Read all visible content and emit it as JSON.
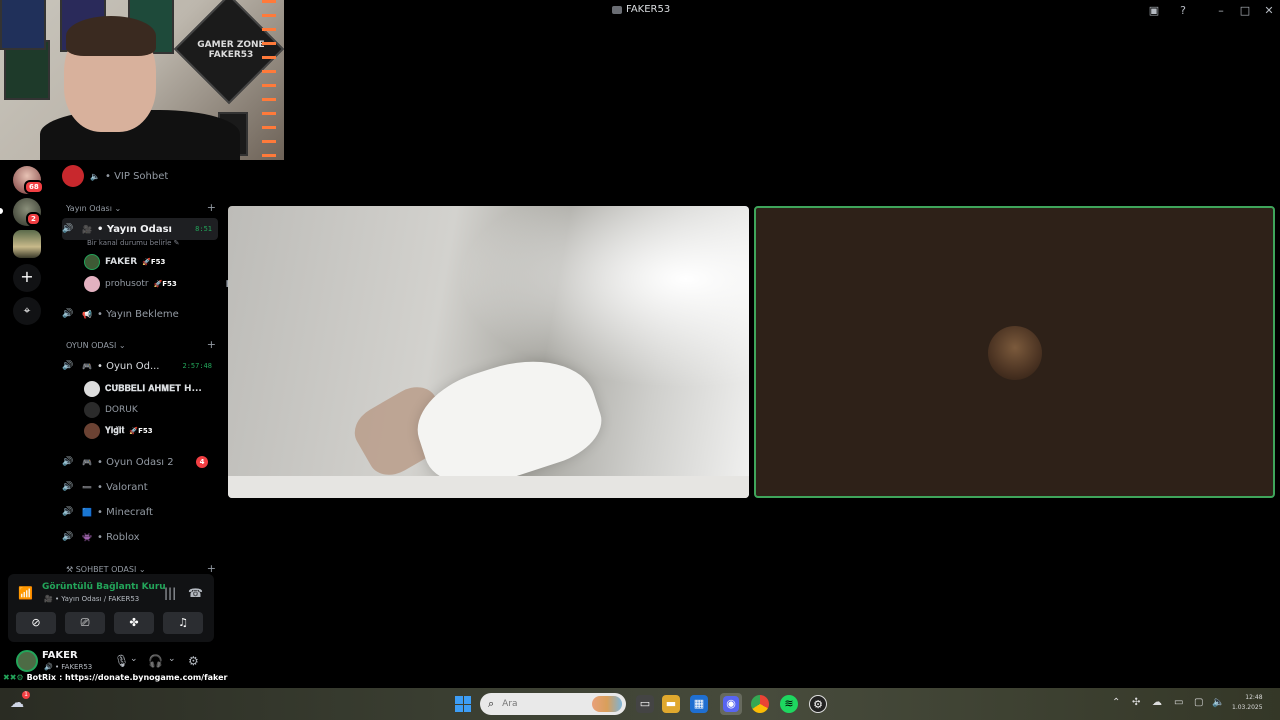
{
  "window": {
    "title": "FAKER53",
    "btn_inbox": "▣",
    "btn_help": "?",
    "btn_minimize": "–",
    "btn_maximize": "□",
    "btn_close": "✕"
  },
  "webcam": {
    "sign_text": "GAMER ZONE FAKER53"
  },
  "servers": {
    "badge_1": "68",
    "badge_2": "2",
    "add": "+",
    "discover": "⌖"
  },
  "channels": {
    "vip": "VIP Sohbet",
    "category_1": "Yayın Odası",
    "active_channel": "Yayın Odası",
    "active_time": "8:51",
    "status_hint": "Bir kanal durumu belirle",
    "users_1": [
      {
        "name": "FAKER",
        "tag": "🚀F53"
      },
      {
        "name": "prohusotr",
        "tag": "🚀F53"
      }
    ],
    "waiting": "Yayın Bekleme",
    "category_2": "OYUN ODASI",
    "game_room": "Oyun Od...",
    "game_time": "2:57:48",
    "users_2": [
      {
        "name": "𝐂𝐔̈𝐁𝐁𝐄𝐋𝐈 𝐀𝐇𝐌𝐄𝐓 H..."
      },
      {
        "name": "DORUK"
      },
      {
        "name": "𝐘𝐢𝐠̆𝐢𝐭",
        "tag": "🚀F53"
      }
    ],
    "game_room_2": "Oyun Odası 2",
    "game_room_2_badge": "4",
    "valorant": "Valorant",
    "minecraft": "Minecraft",
    "roblox": "Roblox",
    "category_3": "SOHBET ODASI",
    "plus": "+"
  },
  "voice_panel": {
    "title": "Görüntülü Bağlantı Kuru",
    "subtitle": "Yayın Odası / FAKER53"
  },
  "user_panel": {
    "name": "FAKER",
    "subtitle": "FAKER53"
  },
  "ticker": {
    "bot": "BotRix",
    "text": ": https://donate.bynogame.com/faker"
  },
  "taskbar": {
    "search_placeholder": "Ara",
    "weather_badge": "1",
    "time": "12:48",
    "date": "1.03.2025"
  },
  "colors": {
    "online_green": "#23a55a",
    "danger_red": "#f23f43",
    "tile_border": "#3fa55b"
  }
}
